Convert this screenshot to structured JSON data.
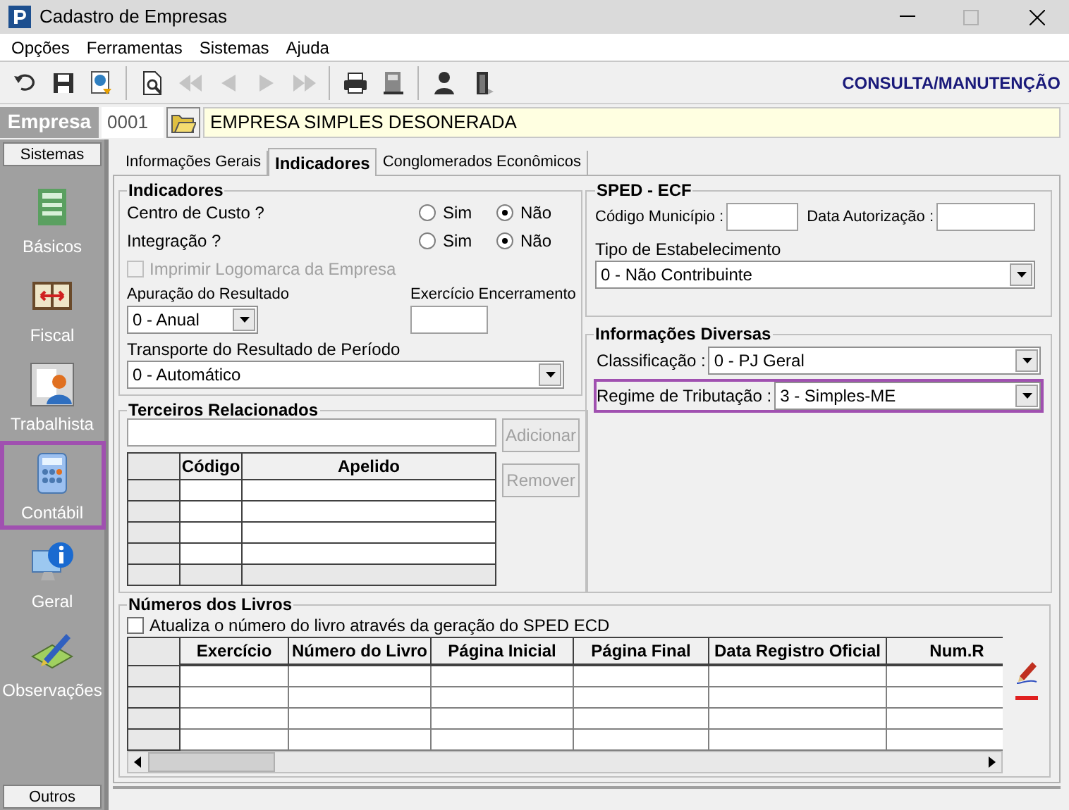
{
  "window": {
    "title": "Cadastro de Empresas"
  },
  "menu": [
    {
      "label": "Opções"
    },
    {
      "label": "Ferramentas"
    },
    {
      "label": "Sistemas"
    },
    {
      "label": "Ajuda"
    }
  ],
  "toolbar": {
    "groups": [
      [
        {
          "kind": "undo",
          "disabled": false
        },
        {
          "kind": "save",
          "disabled": false
        },
        {
          "kind": "export",
          "disabled": false
        }
      ],
      [
        {
          "kind": "preview",
          "disabled": false
        },
        {
          "kind": "first",
          "disabled": true
        },
        {
          "kind": "prev",
          "disabled": true
        },
        {
          "kind": "next",
          "disabled": true
        },
        {
          "kind": "last",
          "disabled": true
        }
      ],
      [
        {
          "kind": "print",
          "disabled": false
        },
        {
          "kind": "machine",
          "disabled": false
        }
      ],
      [
        {
          "kind": "user",
          "disabled": false
        },
        {
          "kind": "exit",
          "disabled": false
        }
      ]
    ],
    "mode": "CONSULTA/MANUTENÇÃO"
  },
  "empresa": {
    "label": "Empresa",
    "code": "0001",
    "name": "EMPRESA SIMPLES DESONERADA"
  },
  "sidebar": {
    "header": "Sistemas",
    "footer": "Outros",
    "items": [
      {
        "label": "Básicos",
        "highlighted": false
      },
      {
        "label": "Fiscal",
        "highlighted": false
      },
      {
        "label": "Trabalhista",
        "highlighted": false
      },
      {
        "label": "Contábil",
        "highlighted": true
      },
      {
        "label": "Geral",
        "highlighted": false
      },
      {
        "label": "Observações",
        "highlighted": false
      }
    ]
  },
  "tabs": [
    {
      "label": "Informações Gerais",
      "selected": false
    },
    {
      "label": "Indicadores",
      "selected": true
    },
    {
      "label": "Conglomerados Econômicos",
      "selected": false
    }
  ],
  "indicadores": {
    "title": "Indicadores",
    "questions": [
      {
        "label": "Centro de Custo ?",
        "options": [
          {
            "label": "Sim",
            "selected": false
          },
          {
            "label": "Não",
            "selected": true
          }
        ]
      },
      {
        "label": "Integração ?",
        "options": [
          {
            "label": "Sim",
            "selected": false
          },
          {
            "label": "Não",
            "selected": true
          }
        ]
      }
    ],
    "logo_checkbox": {
      "label": "Imprimir Logomarca da Empresa",
      "checked": false,
      "disabled": true
    },
    "apuracao": {
      "label": "Apuração do Resultado",
      "value": "0 - Anual"
    },
    "exercicio": {
      "label": "Exercício Encerramento"
    },
    "transporte": {
      "label": "Transporte do Resultado de Período",
      "value": "0 - Automático"
    }
  },
  "terceiros": {
    "title": "Terceiros Relacionados",
    "buttons": [
      {
        "label": "Adicionar",
        "disabled": true
      },
      {
        "label": "Remover",
        "disabled": true
      }
    ],
    "columns": [
      "Código",
      "Apelido"
    ]
  },
  "sped_ecf": {
    "title": "SPED - ECF",
    "codigo_municipio": {
      "label": "Código Município :"
    },
    "data_autorizacao": {
      "label": "Data Autorização :"
    },
    "tipo": {
      "label": "Tipo de Estabelecimento",
      "value": "0 - Não Contribuinte"
    }
  },
  "informacoes_diversas": {
    "title": "Informações Diversas",
    "fields": [
      {
        "label": "Classificação :",
        "value": "0 - PJ Geral",
        "highlighted": false
      },
      {
        "label": "Regime de Tributação :",
        "value": "3 - Simples-ME",
        "highlighted": true
      }
    ]
  },
  "livros": {
    "title": "Números dos Livros",
    "checkbox": {
      "label": "Atualiza o número do livro através da geração do SPED ECD",
      "checked": false
    },
    "columns": [
      "Exercício",
      "Número do Livro",
      "Página Inicial",
      "Página Final",
      "Data Registro Oficial",
      "Num.R"
    ]
  }
}
